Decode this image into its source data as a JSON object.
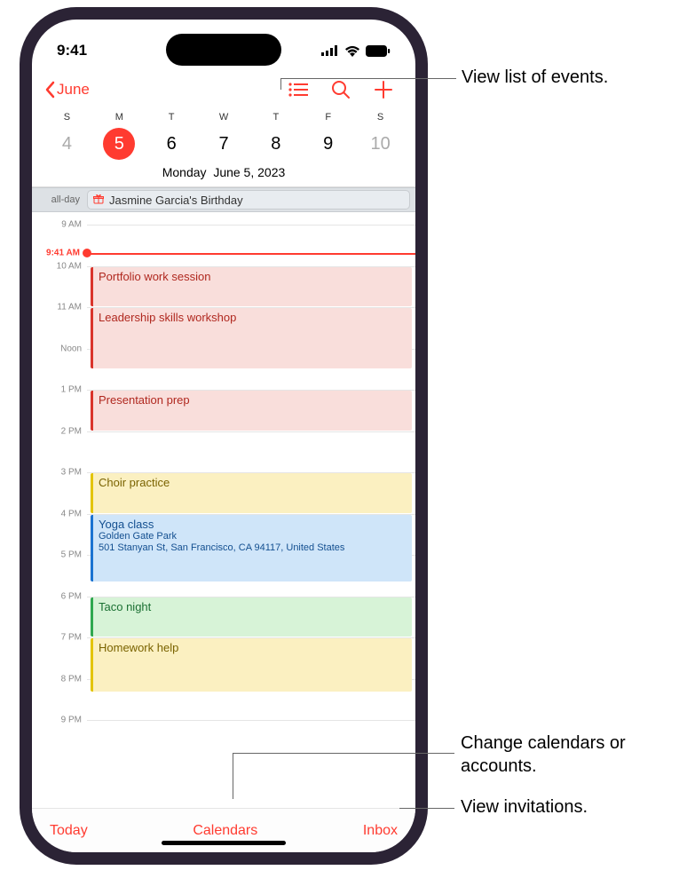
{
  "status": {
    "time": "9:41"
  },
  "nav": {
    "back_label": "June"
  },
  "week": {
    "dows": [
      "S",
      "M",
      "T",
      "W",
      "T",
      "F",
      "S"
    ],
    "nums": [
      "4",
      "5",
      "6",
      "7",
      "8",
      "9",
      "10"
    ],
    "selected_index": 1
  },
  "full_date": {
    "weekday": "Monday",
    "date": "June 5, 2023"
  },
  "allday": {
    "label": "all-day",
    "event_title": "Jasmine Garcia's Birthday"
  },
  "now": {
    "label": "9:41 AM"
  },
  "hours": [
    "9 AM",
    "10 AM",
    "11 AM",
    "Noon",
    "1 PM",
    "2 PM",
    "3 PM",
    "4 PM",
    "5 PM",
    "6 PM",
    "7 PM",
    "8 PM",
    "9 PM"
  ],
  "events": [
    {
      "title": "Portfolio work session",
      "color": "red",
      "start": 10,
      "end": 11
    },
    {
      "title": "Leadership skills workshop",
      "color": "red",
      "start": 11,
      "end": 12.5
    },
    {
      "title": "Presentation prep",
      "color": "red",
      "start": 13,
      "end": 14
    },
    {
      "title": "Choir practice",
      "color": "yellow",
      "start": 15,
      "end": 16
    },
    {
      "title": "Yoga class",
      "sub1": "Golden Gate Park",
      "sub2": "501 Stanyan St, San Francisco, CA 94117, United States",
      "color": "blue",
      "start": 16,
      "end": 17.667
    },
    {
      "title": "Taco night",
      "color": "green",
      "start": 18,
      "end": 19
    },
    {
      "title": "Homework help",
      "color": "yellow",
      "start": 19,
      "end": 20.333
    }
  ],
  "bottom": {
    "today": "Today",
    "calendars": "Calendars",
    "inbox": "Inbox"
  },
  "callouts": {
    "list": "View list of events.",
    "calendars": "Change calendars or accounts.",
    "inbox": "View invitations."
  }
}
